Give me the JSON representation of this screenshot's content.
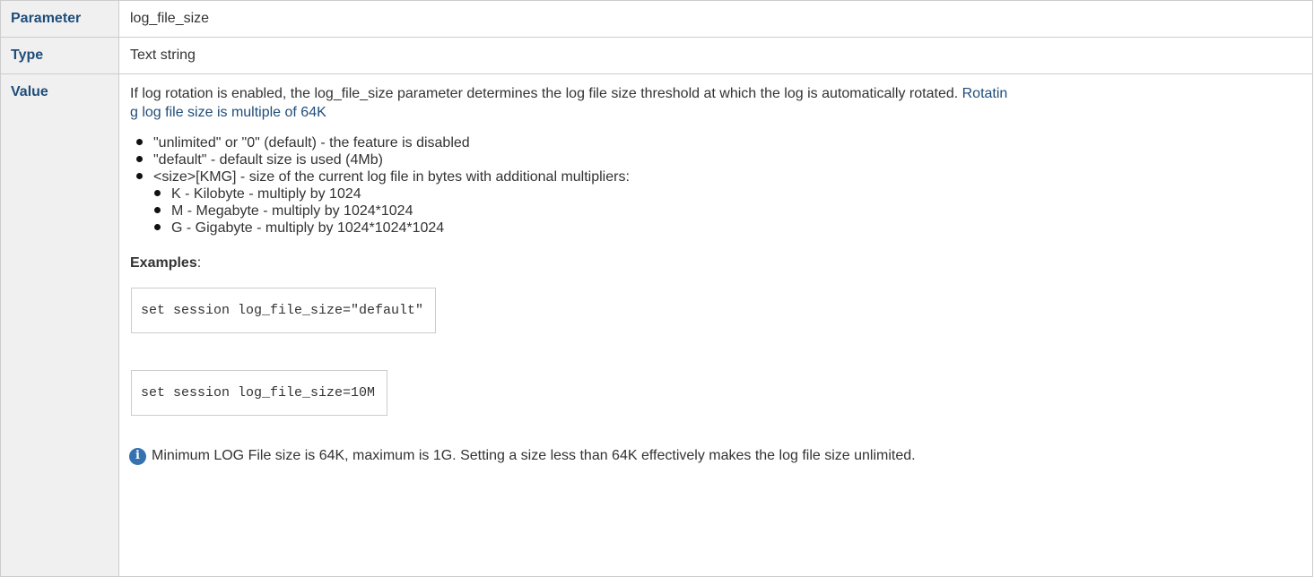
{
  "rows": {
    "parameter": {
      "label": "Parameter",
      "value": "log_file_size"
    },
    "type": {
      "label": "Type",
      "value": "Text string"
    },
    "value": {
      "label": "Value",
      "description": "If log rotation is enabled, the log_file_size parameter determines the log file size threshold at which the log is automatically rotated. ",
      "description_link_line1": "Rotatin",
      "description_link_line2": "g log file size is multiple of 64K",
      "bullets": [
        "\"unlimited\" or \"0\" (default) - the feature is disabled",
        "\"default\" - default size is used (4Mb)",
        "<size>[KMG] - size of the current log file in bytes with additional multipliers:"
      ],
      "sub_bullets": [
        "K - Kilobyte - multiply by 1024",
        "M - Megabyte - multiply by 1024*1024",
        "G - Gigabyte - multiply by 1024*1024*1024"
      ],
      "examples_label": "Examples",
      "examples_colon": ":",
      "code_examples": [
        "set session log_file_size=\"default\"",
        "set session log_file_size=10M"
      ],
      "note_icon": "info-icon",
      "note": "Minimum LOG File size is 64K, maximum is 1G. Setting a size less than 64K effectively makes the log file size unlimited."
    }
  },
  "colors": {
    "header_bg": "#f0f0f0",
    "header_text": "#1f4d7a",
    "border": "#cccccc",
    "info_icon": "#3572b0"
  }
}
